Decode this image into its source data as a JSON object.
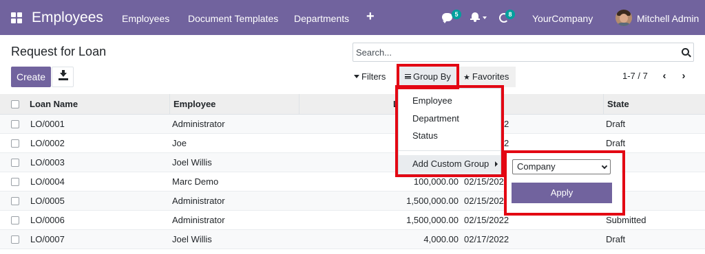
{
  "navbar": {
    "brand": "Employees",
    "menu": [
      "Employees",
      "Document Templates",
      "Departments"
    ],
    "plus_icon": "+",
    "chat_badge": "5",
    "activity_badge": "8",
    "company": "YourCompany",
    "user": "Mitchell Admin"
  },
  "control_panel": {
    "title": "Request for Loan",
    "create_label": "Create",
    "search_placeholder": "Search...",
    "filters_label": "Filters",
    "groupby_label": "Group By",
    "favorites_label": "Favorites",
    "pager": "1-7 / 7"
  },
  "table": {
    "headers": [
      "Loan Name",
      "Employee",
      "L",
      "State"
    ],
    "rows": [
      {
        "name": "LO/0001",
        "employee": "Administrator",
        "amount": "",
        "date": "2",
        "state": "Draft"
      },
      {
        "name": "LO/0002",
        "employee": "Joe",
        "amount": "",
        "date": "2",
        "state": "Draft"
      },
      {
        "name": "LO/0003",
        "employee": "Joel Willis",
        "amount": "",
        "date": "",
        "state": ""
      },
      {
        "name": "LO/0004",
        "employee": "Marc Demo",
        "amount": "100,000.00",
        "date": "02/15/202",
        "state": ""
      },
      {
        "name": "LO/0005",
        "employee": "Administrator",
        "amount": "1,500,000.00",
        "date": "02/15/202",
        "state": ""
      },
      {
        "name": "LO/0006",
        "employee": "Administrator",
        "amount": "1,500,000.00",
        "date": "02/15/2022",
        "state": "Submitted"
      },
      {
        "name": "LO/0007",
        "employee": "Joel Willis",
        "amount": "4,000.00",
        "date": "02/17/2022",
        "state": "Draft"
      }
    ]
  },
  "groupby_menu": {
    "items": [
      "Employee",
      "Department",
      "Status"
    ],
    "custom_group_label": "Add Custom Group",
    "custom_select_value": "Company",
    "apply_label": "Apply"
  },
  "colors": {
    "brand": "#71639e",
    "badge": "#00a09d",
    "highlight": "#e30613"
  },
  "icons": [
    "apps-icon",
    "chat-icon",
    "bell-icon",
    "activity-icon",
    "download-icon",
    "search-icon",
    "funnel-icon",
    "bars-icon",
    "star-icon",
    "chevron-left-icon",
    "chevron-right-icon",
    "caret-right-icon",
    "chevron-down-icon"
  ]
}
